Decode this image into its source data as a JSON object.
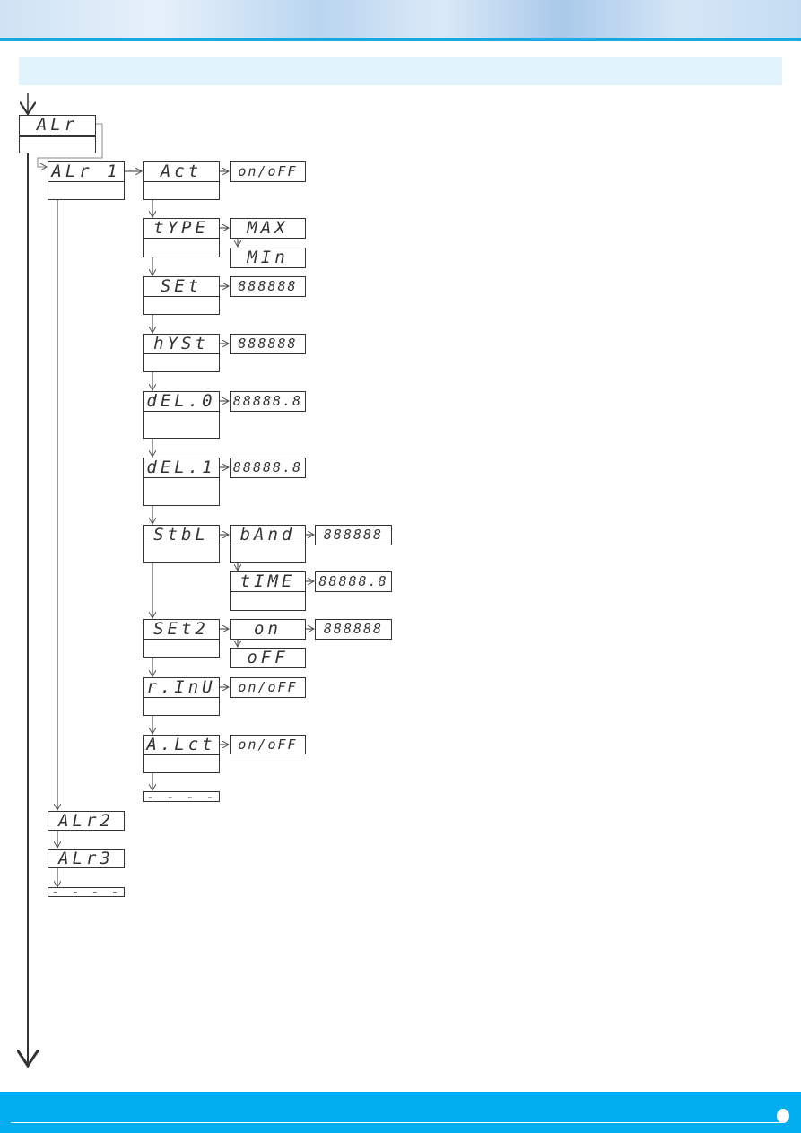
{
  "colors": {
    "accent": "#00aeef",
    "title_bar": "#e1f3fc",
    "line": "#333333"
  },
  "menu": {
    "root": "ALr",
    "alarm1": "ALr 1",
    "alarm2": "ALr2",
    "alarm3": "ALr3",
    "end": "- - - -",
    "params": {
      "act": {
        "label": "Act",
        "value": "on/oFF"
      },
      "type": {
        "label": "tYPE",
        "options": [
          "MAX",
          "MIn"
        ]
      },
      "set": {
        "label": "SEt",
        "value": "888888"
      },
      "hyst": {
        "label": "hYSt",
        "value": "888888"
      },
      "del0": {
        "label": "dEL.0",
        "value": "88888.8"
      },
      "del1": {
        "label": "dEL.1",
        "value": "88888.8"
      },
      "stbl": {
        "label": "StbL",
        "band": "bAnd",
        "band_value": "888888",
        "time": "tIME",
        "time_value": "88888.8"
      },
      "set2": {
        "label": "SEt2",
        "on": "on",
        "on_value": "888888",
        "off": "oFF"
      },
      "rinu": {
        "label": "r.InU",
        "value": "on/oFF"
      },
      "alct": {
        "label": "A.Lct",
        "value": "on/oFF"
      },
      "end": "- - - -"
    }
  }
}
